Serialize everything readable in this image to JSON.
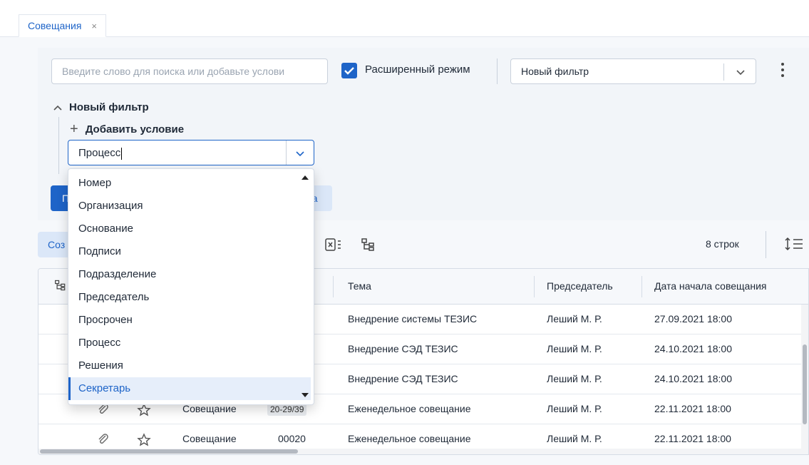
{
  "tabs": [
    {
      "label": "Совещания",
      "close": "×"
    }
  ],
  "filter": {
    "search_placeholder": "Введите слово для поиска или добавьте услови",
    "advanced_label": "Расширенный режим",
    "advanced_checked": true,
    "selected_filter": "Новый фильтр",
    "group_title": "Новый фильтр",
    "add_condition_label": "Добавить условие",
    "condition_value": "Процесс",
    "apply_partial": "П",
    "save_partial": "ра"
  },
  "dropdown": {
    "options": [
      "Номер",
      "Организация",
      "Основание",
      "Подписи",
      "Подразделение",
      "Председатель",
      "Просрочен",
      "Процесс",
      "Решения",
      "Секретарь"
    ],
    "highlighted": "Секретарь"
  },
  "toolbar": {
    "create_partial": "Соз",
    "row_count": "8 строк"
  },
  "table": {
    "headers": [
      "Тема",
      "Председатель",
      "Дата начала совещания"
    ],
    "header_partial": "р",
    "rows": [
      {
        "type": "",
        "number": "",
        "topic": "Внедрение системы ТЕЗИС",
        "chair": "Леший М. Р.",
        "date": "27.09.2021 18:00"
      },
      {
        "type": "",
        "number": "",
        "topic": "Внедрение СЭД ТЕЗИС",
        "chair": "Леший М. Р.",
        "date": "24.10.2021 18:00"
      },
      {
        "type": "",
        "number": "",
        "topic": "Внедрение СЭД ТЕЗИС",
        "chair": "Леший М. Р.",
        "date": "24.10.2021 18:00"
      },
      {
        "type": "Совещание",
        "number": "20-29/39",
        "topic": "Еженедельное совещание",
        "chair": "Леший М. Р.",
        "date": "22.11.2021 18:00"
      },
      {
        "type": "Совещание",
        "number": "00020",
        "topic": "Еженедельное совещание",
        "chair": "Леший М. Р.",
        "date": "22.11.2021 18:00"
      }
    ]
  },
  "colors": {
    "accent": "#1e64c8",
    "selected_bg": "#e6eefa"
  }
}
